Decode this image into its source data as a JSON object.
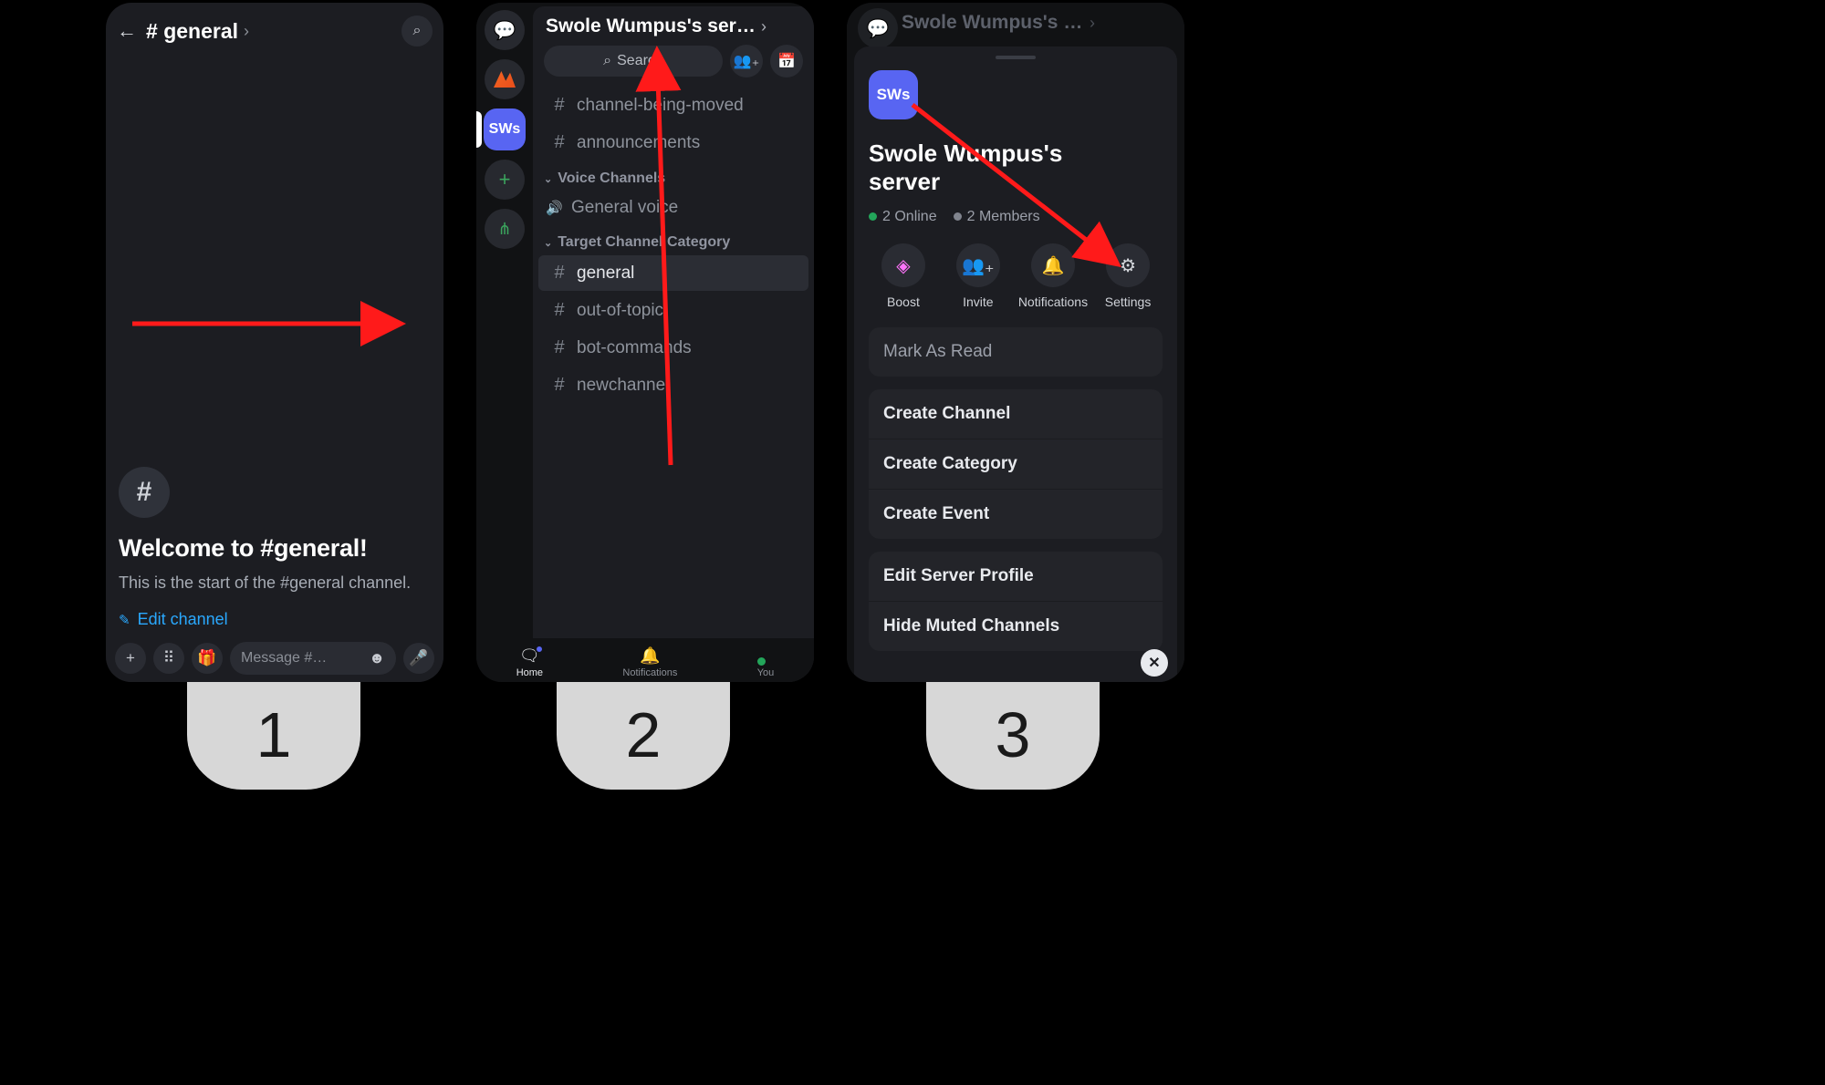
{
  "steps": {
    "one": "1",
    "two": "2",
    "three": "3"
  },
  "phone1": {
    "channel_prefix": "#",
    "channel_name": "general",
    "hash_symbol": "#",
    "welcome": "Welcome to #general!",
    "start_desc": "This is the start of the #general channel.",
    "edit_channel": "Edit channel",
    "message_placeholder": "Message #…",
    "icons": {
      "back": "←",
      "search": "⌕",
      "plus": "+",
      "apps": "⠿",
      "gift": "🎁",
      "emoji": "☻",
      "mic": "🎤",
      "pencil": "✎",
      "chevron": "›"
    }
  },
  "phone2": {
    "server_title": "Swole Wumpus's serv…",
    "server_abbrev": "SWs",
    "search_label": "Search",
    "text_channels": [
      {
        "name": "channel-being-moved"
      },
      {
        "name": "announcements"
      }
    ],
    "voice_header": "Voice Channels",
    "voice_channels": [
      {
        "name": "General voice"
      }
    ],
    "target_header": "Target Channel Category",
    "target_channels": [
      {
        "name": "general",
        "selected": true
      },
      {
        "name": "out-of-topic"
      },
      {
        "name": "bot-commands"
      },
      {
        "name": "newchannel"
      }
    ],
    "nav": {
      "home": "Home",
      "notifications": "Notifications",
      "you": "You"
    },
    "icons": {
      "dm": "💬",
      "plus": "+",
      "hub": "⋔",
      "chevron": "›",
      "search": "⌕",
      "invite": "👥₊",
      "calendar": "📅",
      "hash": "#",
      "speaker": "🔊",
      "caret": "⌄",
      "bell": "🔔",
      "blob": "🟦"
    }
  },
  "phone3": {
    "dim_title": "Swole Wumpus's serv…",
    "server_abbrev": "SWs",
    "server_name": "Swole Wumpus's server",
    "online_count": "2 Online",
    "members_count": "2 Members",
    "actions": {
      "boost": "Boost",
      "invite": "Invite",
      "notifications": "Notifications",
      "settings": "Settings"
    },
    "mark_read": "Mark As Read",
    "create": {
      "channel": "Create Channel",
      "category": "Create Category",
      "event": "Create Event"
    },
    "more": {
      "edit_profile": "Edit Server Profile",
      "hide_muted": "Hide Muted Channels"
    },
    "icons": {
      "dm": "💬",
      "chevron": "›",
      "boost": "◈",
      "invite": "👥₊",
      "bell": "🔔",
      "gear": "⚙",
      "close": "✕"
    }
  }
}
